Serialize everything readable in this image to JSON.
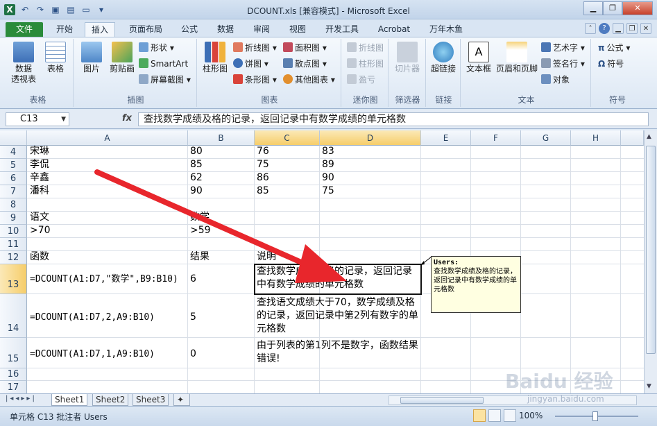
{
  "window": {
    "title": "DCOUNT.xls  [兼容模式] - Microsoft Excel"
  },
  "ribbon_tabs": [
    "文件",
    "开始",
    "插入",
    "页面布局",
    "公式",
    "数据",
    "审阅",
    "视图",
    "开发工具",
    "Acrobat",
    "万年木鱼"
  ],
  "ribbon": {
    "groups": {
      "table": "表格",
      "illus": "插图",
      "charts": "图表",
      "spark": "迷你图",
      "filter": "筛选器",
      "link": "链接",
      "text": "文本",
      "symbol": "符号"
    },
    "buttons": {
      "pivot": "数据\n透视表",
      "table": "表格",
      "picture": "图片",
      "clipart": "剪贴画",
      "shapes": "形状",
      "smartart": "SmartArt",
      "screenshot": "屏幕截图",
      "column": "柱形图",
      "line": "折线图",
      "pie": "饼图",
      "bar": "条形图",
      "area": "面积图",
      "scatter": "散点图",
      "other": "其他图表",
      "sl_line": "折线图",
      "sl_col": "柱形图",
      "sl_wl": "盈亏",
      "slicer": "切片器",
      "hyperlink": "超链接",
      "textbox": "文本框",
      "headerfooter": "页眉和页脚",
      "wordart": "艺术字",
      "signature": "签名行",
      "object": "对象",
      "equation": "公式",
      "symbol": "符号"
    }
  },
  "formula_bar": {
    "name_box": "C13",
    "fx": "fx",
    "formula": "查找数学成绩及格的记录，返回记录中有数学成绩的单元格数"
  },
  "columns": [
    "A",
    "B",
    "C",
    "D",
    "E",
    "F",
    "G",
    "H"
  ],
  "rows": [
    "4",
    "5",
    "6",
    "7",
    "8",
    "9",
    "10",
    "11",
    "12",
    "13",
    "14",
    "15",
    "16",
    "17"
  ],
  "cells": {
    "A4": "宋琳",
    "B4": "80",
    "C4": "76",
    "D4": "83",
    "A5": "李侃",
    "B5": "85",
    "C5": "75",
    "D5": "89",
    "A6": "辛鑫",
    "B6": "62",
    "C6": "86",
    "D6": "90",
    "A7": "潘科",
    "B7": "90",
    "C7": "85",
    "D7": "75",
    "A9": "语文",
    "B9": "数学",
    "A10": ">70",
    "B10": ">59",
    "A12": "函数",
    "B12": "结果",
    "C12": "说明",
    "A13": "=DCOUNT(A1:D7,\"数学\",B9:B10)",
    "B13": "6",
    "C13": "查找数学成绩及格的记录，返回记录中有数学成绩的单元格数",
    "A14": "=DCOUNT(A1:D7,2,A9:B10)",
    "B14": "5",
    "C14": "查找语文成绩大于70，数学成绩及格的记录，返回记录中第2列有数字的单元格数",
    "A15": "=DCOUNT(A1:D7,1,A9:B10)",
    "B15": "0",
    "C15": "由于列表的第1列不是数字，函数结果错误!"
  },
  "comment": {
    "author": "Users:",
    "text": "查找数学成绩及格的记录，返回记录中有数学成绩的单元格数"
  },
  "sheets": [
    "Sheet1",
    "Sheet2",
    "Sheet3"
  ],
  "status": {
    "text": "单元格 C13 批注者 Users",
    "zoom": "100%"
  },
  "watermark": {
    "brand": "Baidu 经验",
    "url": "jingyan.baidu.com"
  },
  "colors": {
    "file_tab": "#2a8b3a",
    "arrow": "#e8262c",
    "selected_header": "#f6cd6a"
  }
}
